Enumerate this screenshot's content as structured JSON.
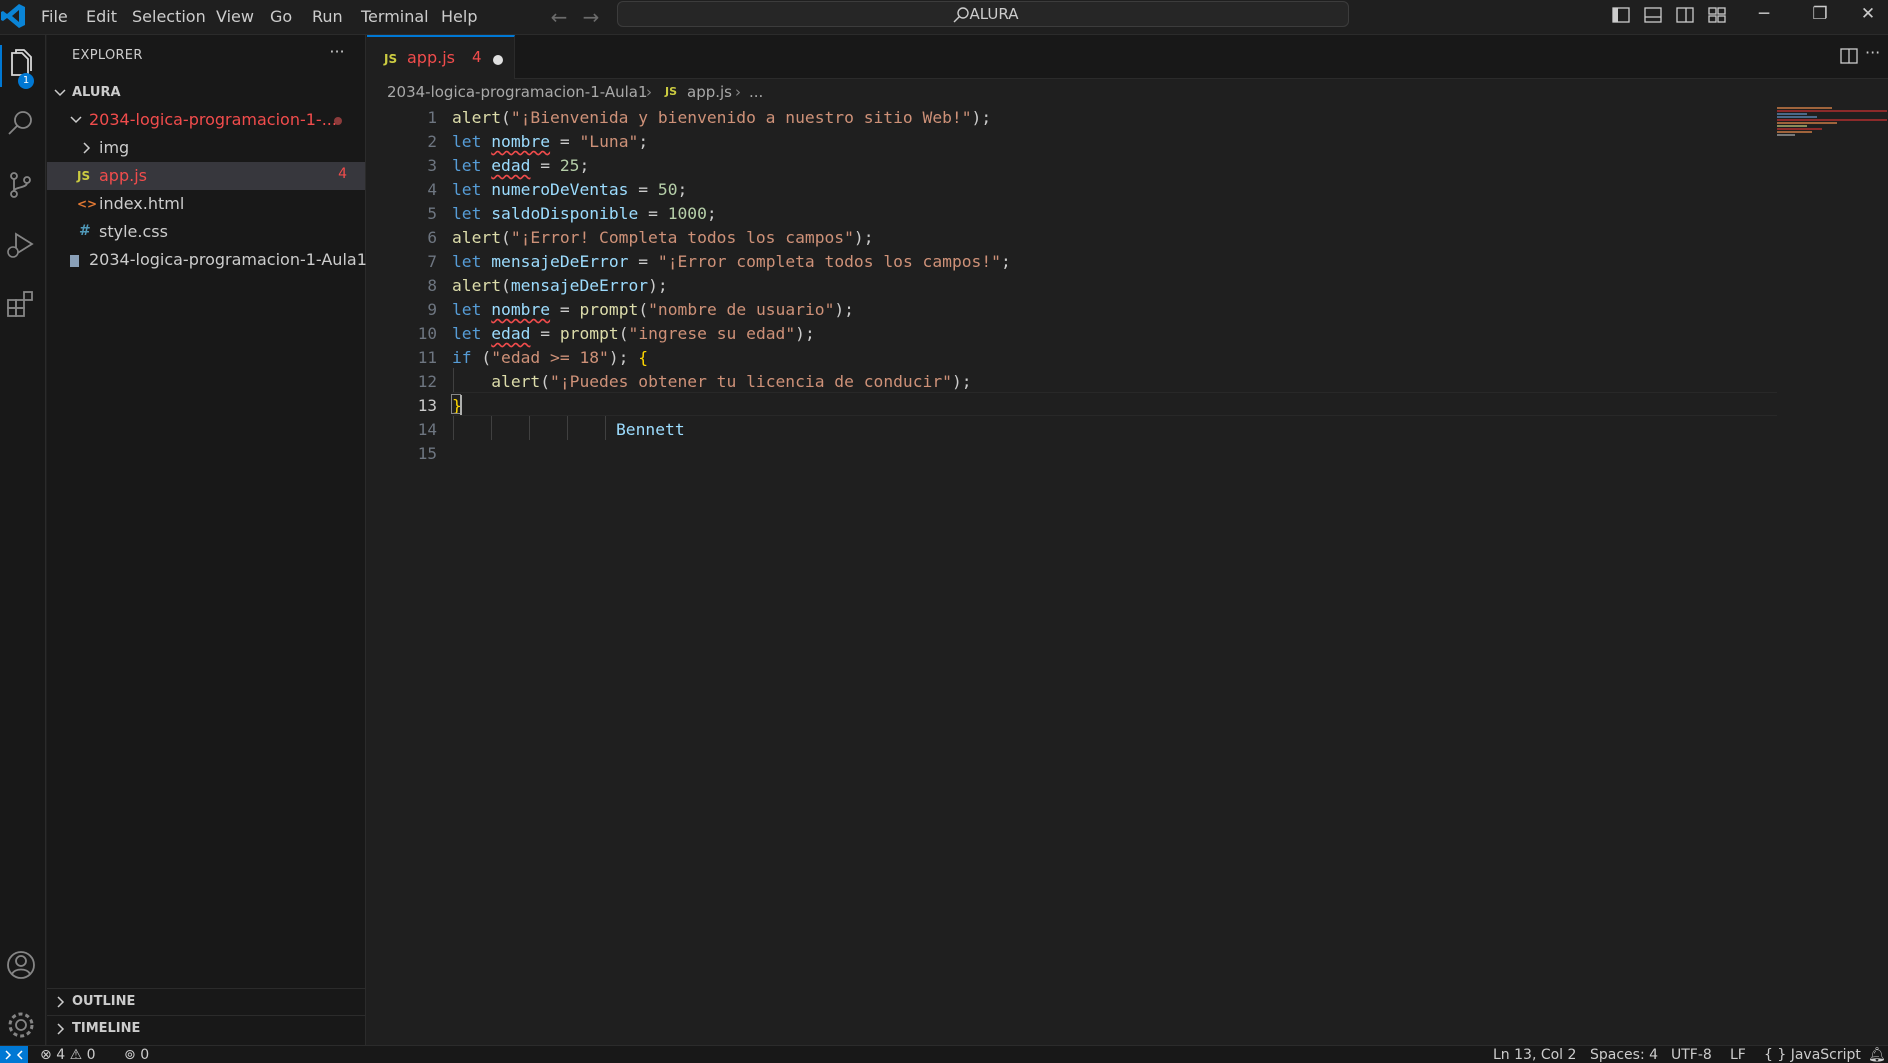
{
  "menu": [
    "File",
    "Edit",
    "Selection",
    "View",
    "Go",
    "Run",
    "Terminal",
    "Help"
  ],
  "command_center": {
    "label": "ALURA"
  },
  "activity_bar": {
    "explorer_badge": "1"
  },
  "sidebar": {
    "title": "EXPLORER",
    "more": "···",
    "root": "ALURA",
    "folder": "2034-logica-programacion-1-...",
    "items": [
      {
        "label": "img",
        "type": "folder"
      },
      {
        "label": "app.js",
        "type": "js",
        "badge": "4"
      },
      {
        "label": "index.html",
        "type": "html"
      },
      {
        "label": "style.css",
        "type": "css"
      }
    ],
    "root_file": "2034-logica-programacion-1-Aula1....",
    "outline": "OUTLINE",
    "timeline": "TIMELINE"
  },
  "tab": {
    "icon": "JS",
    "label": "app.js",
    "problems": "4"
  },
  "editor_more": "···",
  "breadcrumb": {
    "folder": "2034-logica-programacion-1-Aula1",
    "icon": "JS",
    "file": "app.js",
    "rest": "..."
  },
  "code": {
    "line_numbers": [
      "1",
      "2",
      "3",
      "4",
      "5",
      "6",
      "7",
      "8",
      "9",
      "10",
      "11",
      "12",
      "13",
      "14",
      "15"
    ],
    "active_line": 13,
    "ghost_text": "Bennett"
  },
  "status": {
    "errors": "4",
    "warnings": "0",
    "ports": "0",
    "position": "Ln 13, Col 2",
    "spaces": "Spaces: 4",
    "encoding": "UTF-8",
    "eol": "LF",
    "language": "JavaScript",
    "language_icon": "{ }"
  },
  "colors": {
    "accent": "#0078d4",
    "error": "#f14c4c",
    "keyword": "#569cd6",
    "string": "#ce9178",
    "function": "#dcdcaa",
    "variable": "#9cdcfe",
    "number": "#b5cea8"
  }
}
